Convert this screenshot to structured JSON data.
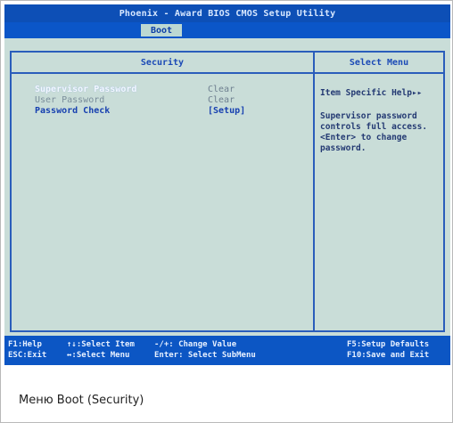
{
  "bios": {
    "title": "Phoenix - Award BIOS CMOS Setup Utility",
    "active_tab": "Boot",
    "section_title": "Security",
    "help_header": "Select Menu",
    "items": [
      {
        "label": "Supervisor Password",
        "value": "Clear"
      },
      {
        "label": "User Password",
        "value": "Clear"
      },
      {
        "label": "Password Check",
        "value": "[Setup]"
      }
    ],
    "help": {
      "title": "Item Specific Help▸▸",
      "text": "Supervisor password\ncontrols full access.\n<Enter> to change\npassword."
    },
    "keys": {
      "f1": "F1:Help",
      "esc": "ESC:Exit",
      "updown": "↑↓:Select Item",
      "leftright": "↔:Select Menu",
      "change": "-/+: Change Value",
      "enter": "Enter: Select SubMenu",
      "f5": "F5:Setup Defaults",
      "f10": "F10:Save and Exit"
    }
  },
  "caption": "Меню Boot (Security)"
}
